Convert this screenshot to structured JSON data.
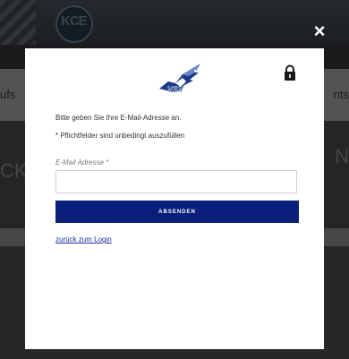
{
  "background": {
    "nav_left_text": "ufs",
    "nav_right_text": "nts",
    "mid_left_text": "CK",
    "mid_right_text": "N",
    "logo_text": "KCE"
  },
  "modal": {
    "close_label": "×",
    "logo_text": "VSV",
    "intro_text": "Bitte geben Sie Ihre E-Mail-Adresse an.",
    "required_note": "* Pflichtfelder sind unbedingt auszufüllen",
    "email_label": "E-Mail Adresse *",
    "email_value": "",
    "submit_label": "ABSENDEN",
    "back_link": "zurück zum Login"
  },
  "colors": {
    "primary_button": "#0a1f7c",
    "link": "#1a2f9c"
  },
  "icons": {
    "close": "close-icon",
    "lock": "lock-icon",
    "logo": "eagle-logo-icon"
  }
}
